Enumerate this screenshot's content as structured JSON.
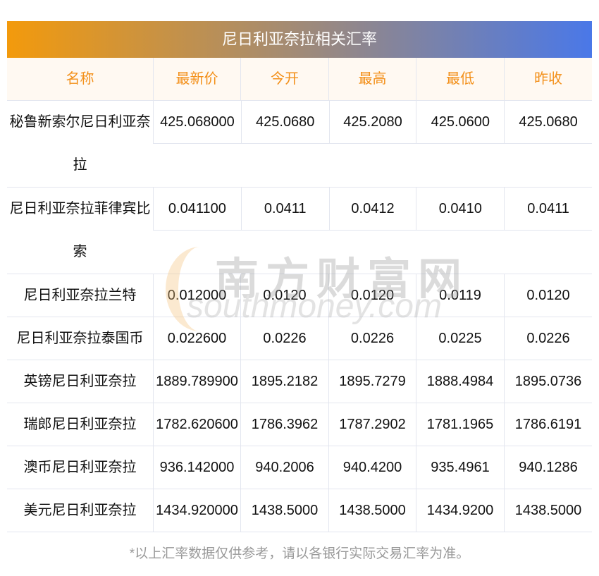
{
  "title": "尼日利亚奈拉相关汇率",
  "headers": [
    "名称",
    "最新价",
    "今开",
    "最高",
    "最低",
    "昨收"
  ],
  "rows": [
    {
      "name": "秘鲁新索尔尼日利亚奈拉",
      "v": [
        "425.068000",
        "425.0680",
        "425.2080",
        "425.0600",
        "425.0680"
      ]
    },
    {
      "name": "尼日利亚奈拉菲律宾比索",
      "v": [
        "0.041100",
        "0.0411",
        "0.0412",
        "0.0410",
        "0.0411"
      ]
    },
    {
      "name": "尼日利亚奈拉兰特",
      "v": [
        "0.012000",
        "0.0120",
        "0.0120",
        "0.0119",
        "0.0120"
      ]
    },
    {
      "name": "尼日利亚奈拉泰国币",
      "v": [
        "0.022600",
        "0.0226",
        "0.0226",
        "0.0225",
        "0.0226"
      ]
    },
    {
      "name": "英镑尼日利亚奈拉",
      "v": [
        "1889.789900",
        "1895.2182",
        "1895.7279",
        "1888.4984",
        "1895.0736"
      ]
    },
    {
      "name": "瑞郎尼日利亚奈拉",
      "v": [
        "1782.620600",
        "1786.3962",
        "1787.2902",
        "1781.1965",
        "1786.6191"
      ]
    },
    {
      "name": "澳币尼日利亚奈拉",
      "v": [
        "936.142000",
        "940.2006",
        "940.4200",
        "935.4961",
        "940.1286"
      ]
    },
    {
      "name": "美元尼日利亚奈拉",
      "v": [
        "1434.920000",
        "1438.5000",
        "1438.5000",
        "1434.9200",
        "1438.5000"
      ]
    }
  ],
  "note": "*以上汇率数据仅供参考，请以各银行实际交易汇率为准。",
  "watermark": {
    "cn": "南方财富网",
    "en": "southmoney.com"
  }
}
